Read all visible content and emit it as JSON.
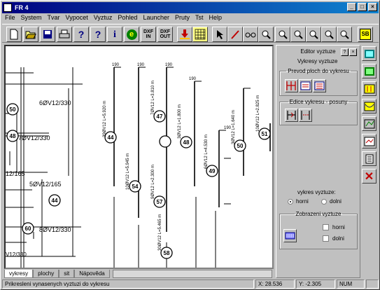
{
  "window": {
    "title": "FR 4",
    "min": "_",
    "max": "□",
    "close": "×"
  },
  "menu": [
    "File",
    "System",
    "Tvar",
    "Vypocet",
    "Vyztuz",
    "Pohled",
    "Launcher",
    "Pruty",
    "Tst",
    "Help"
  ],
  "toolbar": {
    "dxf_in": "DXF IN",
    "dxf_out": "DXF OUT",
    "info": "i",
    "help": "?",
    "help2": "?",
    "e": "e"
  },
  "panel": {
    "title": "Editor vyztuze",
    "help": "?",
    "close": "×",
    "group_vykresy": "Vykresy vyztuze",
    "group_prevod": "Prevod ploch do vykresu",
    "group_edice": "Edice vykresu - posuny",
    "vykres_label": "vykres vyztuze:",
    "radio_horni": "horni",
    "radio_dolni": "dolni",
    "group_zobrazeni": "Zobrazeni vyztuze",
    "chk_horni": "horni",
    "chk_dolni": "dolni"
  },
  "tabs": [
    "vykresy",
    "plochy",
    "sit",
    "Nápověda"
  ],
  "status": {
    "message": "Prikresleni vynasenych vyztuzi do vykresu",
    "x": "X: 28.536",
    "y": "Y: -2.305",
    "num": "NUM"
  },
  "drawing": {
    "left_labels": [
      "6ØV12/330",
      "7ØV12/330",
      "5ØV12/165",
      "12/165",
      "8ØV12/330",
      "V12/330"
    ],
    "bubbles": [
      "44",
      "47",
      "48",
      "49",
      "50",
      "51",
      "54",
      "55",
      "57",
      "58",
      "60",
      "62"
    ],
    "dims": [
      "190",
      "600",
      "500"
    ],
    "bar_texts": [
      "39ØV12 L=5.920 m",
      "7ØV12 L=3.810 m",
      "3ØV12 L=1.800 m",
      "10ØV12 L=2.825 m",
      "10ØV12 L=5.945 m",
      "9ØV12 L=2.300 m",
      "6ØV12 L=4.530 m",
      "3ØV12 L=1.640 m",
      "30ØV12 L=5.465 m"
    ]
  }
}
